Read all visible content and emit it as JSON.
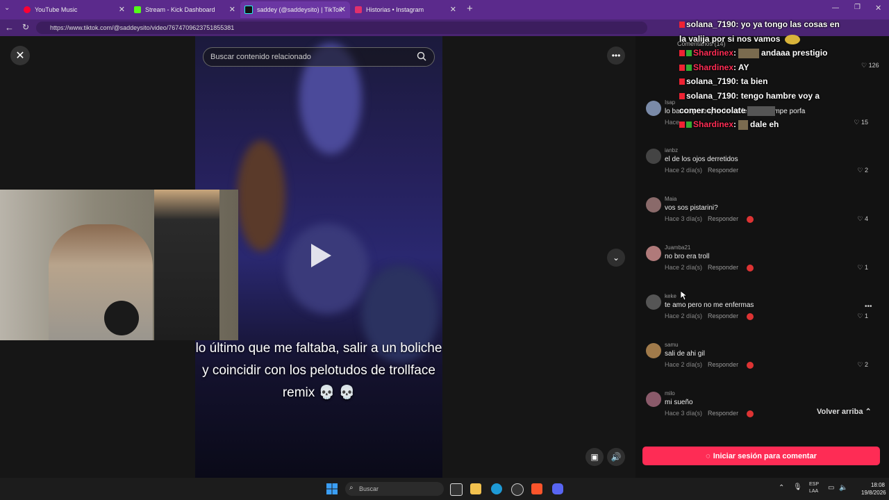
{
  "browser": {
    "tabs": [
      {
        "title": "YouTube Music",
        "color": "#ff0033"
      },
      {
        "title": "Stream - Kick Dashboard",
        "color": "#53fc18"
      },
      {
        "title": "saddey (@saddeysito) | TikTok",
        "color": "#000000"
      },
      {
        "title": "Historias • Instagram",
        "color": "#e1306c"
      }
    ],
    "url": "https://www.tiktok.com/@saddeysito/video/7674709623751855381"
  },
  "video": {
    "search_placeholder": "Buscar contenido relacionado",
    "caption": "lo último que me faltaba, salir a un boliche y coincidir con los pelotudos de trollface remix 💀 💀"
  },
  "comments_header": "Comentarios (14)",
  "comments": [
    {
      "user": "Isap",
      "text": "lo banco pero q le de un fernet a campe porfa",
      "time": "Hace",
      "likes": "15",
      "color": "#7a8aa8"
    },
    {
      "user": "ianbz",
      "text": "el de los ojos derretidos",
      "time": "Hace 2 día(s)",
      "likes": "2",
      "color": "#444"
    },
    {
      "user": "Maia",
      "text": "vos sos pistarini?",
      "time": "Hace 3 día(s)",
      "likes": "4",
      "color": "#8a6a6a"
    },
    {
      "user": "Juamba21",
      "text": "no bro era troll",
      "time": "Hace 2 día(s)",
      "likes": "1",
      "color": "#b07a7a"
    },
    {
      "user": "keke",
      "text": "te amo pero no me enfermas",
      "time": "Hace 2 día(s)",
      "likes": "1",
      "color": "#555"
    },
    {
      "user": "samu",
      "text": "sali de ahi gil",
      "time": "Hace 2 día(s)",
      "likes": "2",
      "color": "#a07a4a"
    },
    {
      "user": "milo",
      "text": "mi sueño",
      "time": "Hace 3 día(s)",
      "likes": "",
      "color": "#8a5a6a"
    }
  ],
  "reply_label": "Responder",
  "top_likes": "126",
  "back_to_top": "Volver arriba",
  "login_button": "Iniciar sesión para comentar",
  "chat": [
    {
      "name": "solana_7190",
      "msg": "yo ya tongo las cosas en",
      "type": "g"
    },
    {
      "name": "",
      "msg": "la valija por si nos vamos",
      "type": "cont"
    },
    {
      "name": "Shardinex",
      "msg": "andaaa prestigio",
      "type": "r"
    },
    {
      "name": "Shardinex",
      "msg": "AY",
      "type": "r"
    },
    {
      "name": "solana_7190",
      "msg": "ta bien",
      "type": "g"
    },
    {
      "name": "solana_7190",
      "msg": "tengo hambre voy a",
      "type": "g"
    },
    {
      "name": "",
      "msg": "comer chocolate",
      "type": "cont"
    },
    {
      "name": "Shardinex",
      "msg": "dale eh",
      "type": "r"
    }
  ],
  "taskbar": {
    "search": "Buscar",
    "lang": "ESP",
    "region": "LAA",
    "time": "18:08",
    "date": "19/8/2026"
  }
}
